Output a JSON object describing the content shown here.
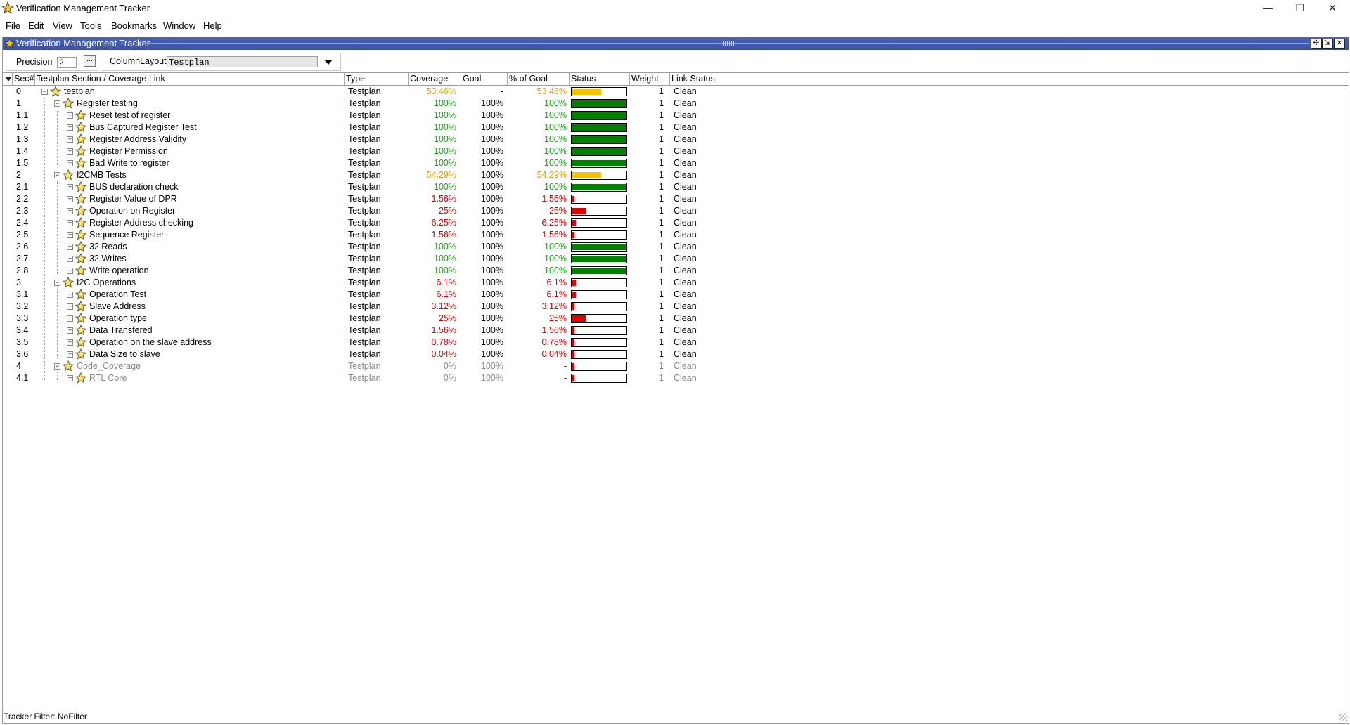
{
  "window": {
    "title": "Verification Management Tracker",
    "minimize": "—",
    "restore": "❐",
    "close": "✕"
  },
  "menu": [
    "File",
    "Edit",
    "View",
    "Tools",
    "Bookmarks",
    "Window",
    "Help"
  ],
  "pane": {
    "title": "Verification Management Tracker"
  },
  "toolbar": {
    "precision_label": "Precision",
    "precision_value": "2",
    "column_layout_label": "ColumnLayout",
    "column_layout_value": "Testplan"
  },
  "columns": [
    "Sec#",
    "Testplan Section / Coverage Link",
    "Type",
    "Coverage",
    "Goal",
    "% of Goal",
    "Status",
    "Weight",
    "Link Status"
  ],
  "rows": [
    {
      "sec": "0",
      "name": "testplan",
      "level": 0,
      "toggle": "−",
      "type": "Testplan",
      "coverage": "53.46%",
      "goal": "-",
      "pct_goal": "53.46%",
      "progress": 53.46,
      "weight": "1",
      "link": "Clean",
      "tone": "amber"
    },
    {
      "sec": "1",
      "name": "Register testing",
      "level": 1,
      "toggle": "−",
      "type": "Testplan",
      "coverage": "100%",
      "goal": "100%",
      "pct_goal": "100%",
      "progress": 100,
      "weight": "1",
      "link": "Clean",
      "tone": "green"
    },
    {
      "sec": "1.1",
      "name": "Reset test of register",
      "level": 2,
      "toggle": "+",
      "type": "Testplan",
      "coverage": "100%",
      "goal": "100%",
      "pct_goal": "100%",
      "progress": 100,
      "weight": "1",
      "link": "Clean",
      "tone": "green"
    },
    {
      "sec": "1.2",
      "name": "Bus Captured Register Test",
      "level": 2,
      "toggle": "+",
      "type": "Testplan",
      "coverage": "100%",
      "goal": "100%",
      "pct_goal": "100%",
      "progress": 100,
      "weight": "1",
      "link": "Clean",
      "tone": "green"
    },
    {
      "sec": "1.3",
      "name": "Register Address Validity",
      "level": 2,
      "toggle": "+",
      "type": "Testplan",
      "coverage": "100%",
      "goal": "100%",
      "pct_goal": "100%",
      "progress": 100,
      "weight": "1",
      "link": "Clean",
      "tone": "green"
    },
    {
      "sec": "1.4",
      "name": "Register Permission",
      "level": 2,
      "toggle": "+",
      "type": "Testplan",
      "coverage": "100%",
      "goal": "100%",
      "pct_goal": "100%",
      "progress": 100,
      "weight": "1",
      "link": "Clean",
      "tone": "green"
    },
    {
      "sec": "1.5",
      "name": "Bad Write to register",
      "level": 2,
      "toggle": "+",
      "type": "Testplan",
      "coverage": "100%",
      "goal": "100%",
      "pct_goal": "100%",
      "progress": 100,
      "weight": "1",
      "link": "Clean",
      "tone": "green"
    },
    {
      "sec": "2",
      "name": "I2CMB Tests",
      "level": 1,
      "toggle": "−",
      "type": "Testplan",
      "coverage": "54.29%",
      "goal": "100%",
      "pct_goal": "54.29%",
      "progress": 54.29,
      "weight": "1",
      "link": "Clean",
      "tone": "amber"
    },
    {
      "sec": "2.1",
      "name": "BUS declaration check",
      "level": 2,
      "toggle": "+",
      "type": "Testplan",
      "coverage": "100%",
      "goal": "100%",
      "pct_goal": "100%",
      "progress": 100,
      "weight": "1",
      "link": "Clean",
      "tone": "green"
    },
    {
      "sec": "2.2",
      "name": "Register Value of DPR",
      "level": 2,
      "toggle": "+",
      "type": "Testplan",
      "coverage": "1.56%",
      "goal": "100%",
      "pct_goal": "1.56%",
      "progress": 1.56,
      "weight": "1",
      "link": "Clean",
      "tone": "red"
    },
    {
      "sec": "2.3",
      "name": "Operation on Register",
      "level": 2,
      "toggle": "+",
      "type": "Testplan",
      "coverage": "25%",
      "goal": "100%",
      "pct_goal": "25%",
      "progress": 25,
      "weight": "1",
      "link": "Clean",
      "tone": "red"
    },
    {
      "sec": "2.4",
      "name": "Register Address checking",
      "level": 2,
      "toggle": "+",
      "type": "Testplan",
      "coverage": "6.25%",
      "goal": "100%",
      "pct_goal": "6.25%",
      "progress": 6.25,
      "weight": "1",
      "link": "Clean",
      "tone": "red"
    },
    {
      "sec": "2.5",
      "name": "Sequence Register",
      "level": 2,
      "toggle": "+",
      "type": "Testplan",
      "coverage": "1.56%",
      "goal": "100%",
      "pct_goal": "1.56%",
      "progress": 1.56,
      "weight": "1",
      "link": "Clean",
      "tone": "red"
    },
    {
      "sec": "2.6",
      "name": "32 Reads",
      "level": 2,
      "toggle": "+",
      "type": "Testplan",
      "coverage": "100%",
      "goal": "100%",
      "pct_goal": "100%",
      "progress": 100,
      "weight": "1",
      "link": "Clean",
      "tone": "green"
    },
    {
      "sec": "2.7",
      "name": "32 Writes",
      "level": 2,
      "toggle": "+",
      "type": "Testplan",
      "coverage": "100%",
      "goal": "100%",
      "pct_goal": "100%",
      "progress": 100,
      "weight": "1",
      "link": "Clean",
      "tone": "green"
    },
    {
      "sec": "2.8",
      "name": "Write operation",
      "level": 2,
      "toggle": "+",
      "type": "Testplan",
      "coverage": "100%",
      "goal": "100%",
      "pct_goal": "100%",
      "progress": 100,
      "weight": "1",
      "link": "Clean",
      "tone": "green"
    },
    {
      "sec": "3",
      "name": "I2C Operations",
      "level": 1,
      "toggle": "−",
      "type": "Testplan",
      "coverage": "6.1%",
      "goal": "100%",
      "pct_goal": "6.1%",
      "progress": 6.1,
      "weight": "1",
      "link": "Clean",
      "tone": "red"
    },
    {
      "sec": "3.1",
      "name": "Operation Test",
      "level": 2,
      "toggle": "+",
      "type": "Testplan",
      "coverage": "6.1%",
      "goal": "100%",
      "pct_goal": "6.1%",
      "progress": 6.1,
      "weight": "1",
      "link": "Clean",
      "tone": "red"
    },
    {
      "sec": "3.2",
      "name": "Slave Address",
      "level": 2,
      "toggle": "+",
      "type": "Testplan",
      "coverage": "3.12%",
      "goal": "100%",
      "pct_goal": "3.12%",
      "progress": 3.12,
      "weight": "1",
      "link": "Clean",
      "tone": "red"
    },
    {
      "sec": "3.3",
      "name": "Operation type",
      "level": 2,
      "toggle": "+",
      "type": "Testplan",
      "coverage": "25%",
      "goal": "100%",
      "pct_goal": "25%",
      "progress": 25,
      "weight": "1",
      "link": "Clean",
      "tone": "red"
    },
    {
      "sec": "3.4",
      "name": "Data Transfered",
      "level": 2,
      "toggle": "+",
      "type": "Testplan",
      "coverage": "1.56%",
      "goal": "100%",
      "pct_goal": "1.56%",
      "progress": 1.56,
      "weight": "1",
      "link": "Clean",
      "tone": "red"
    },
    {
      "sec": "3.5",
      "name": "Operation on the slave address",
      "level": 2,
      "toggle": "+",
      "type": "Testplan",
      "coverage": "0.78%",
      "goal": "100%",
      "pct_goal": "0.78%",
      "progress": 0.78,
      "weight": "1",
      "link": "Clean",
      "tone": "red"
    },
    {
      "sec": "3.6",
      "name": "Data Size to slave",
      "level": 2,
      "toggle": "+",
      "type": "Testplan",
      "coverage": "0.04%",
      "goal": "100%",
      "pct_goal": "0.04%",
      "progress": 0.04,
      "weight": "1",
      "link": "Clean",
      "tone": "red"
    },
    {
      "sec": "4",
      "name": "Code_Coverage",
      "level": 1,
      "toggle": "−",
      "type": "Testplan",
      "coverage": "0%",
      "goal": "100%",
      "pct_goal": "-",
      "progress": 0,
      "weight": "1",
      "link": "Clean",
      "tone": "grey"
    },
    {
      "sec": "4.1",
      "name": "RTL Core",
      "level": 2,
      "toggle": "+",
      "type": "Testplan",
      "coverage": "0%",
      "goal": "100%",
      "pct_goal": "-",
      "progress": 0,
      "weight": "1",
      "link": "Clean",
      "tone": "grey"
    }
  ],
  "colors": {
    "green_bar": "#008000",
    "amber_bar": "#f5c400",
    "red_bar": "#e00000",
    "pane_title": "#4a5fb0"
  },
  "status_bar": {
    "text": "Tracker Filter: NoFilter"
  }
}
